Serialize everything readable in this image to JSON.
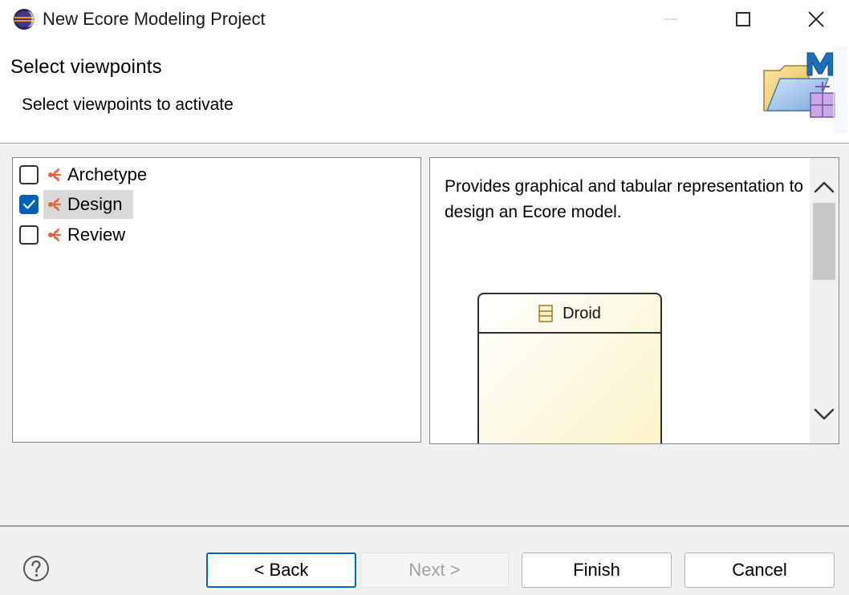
{
  "window": {
    "title": "New Ecore Modeling Project",
    "icon": "eclipse-icon",
    "controls": [
      "minimize-icon",
      "maximize-icon",
      "close-icon"
    ]
  },
  "banner": {
    "title": "Select viewpoints",
    "description": "Select viewpoints to activate",
    "image": "ecore-modeling-wizard-icon"
  },
  "viewpoints": [
    {
      "label": "Archetype",
      "checked": false,
      "selected": false,
      "icon": "viewpoint-icon"
    },
    {
      "label": "Design",
      "checked": true,
      "selected": true,
      "icon": "viewpoint-icon"
    },
    {
      "label": "Review",
      "checked": false,
      "selected": false,
      "icon": "viewpoint-icon"
    }
  ],
  "description_panel": {
    "text": "Provides graphical and tabular representation to design an Ecore model.",
    "preview_class_name": "Droid"
  },
  "footer": {
    "help_icon": "help-icon",
    "back_label": "< Back",
    "next_label": "Next >",
    "finish_label": "Finish",
    "cancel_label": "Cancel",
    "next_enabled": false
  },
  "colors": {
    "accent": "#005fb8",
    "viewpoint_icon": "#e8603c",
    "selection": "#d9d9d9"
  }
}
